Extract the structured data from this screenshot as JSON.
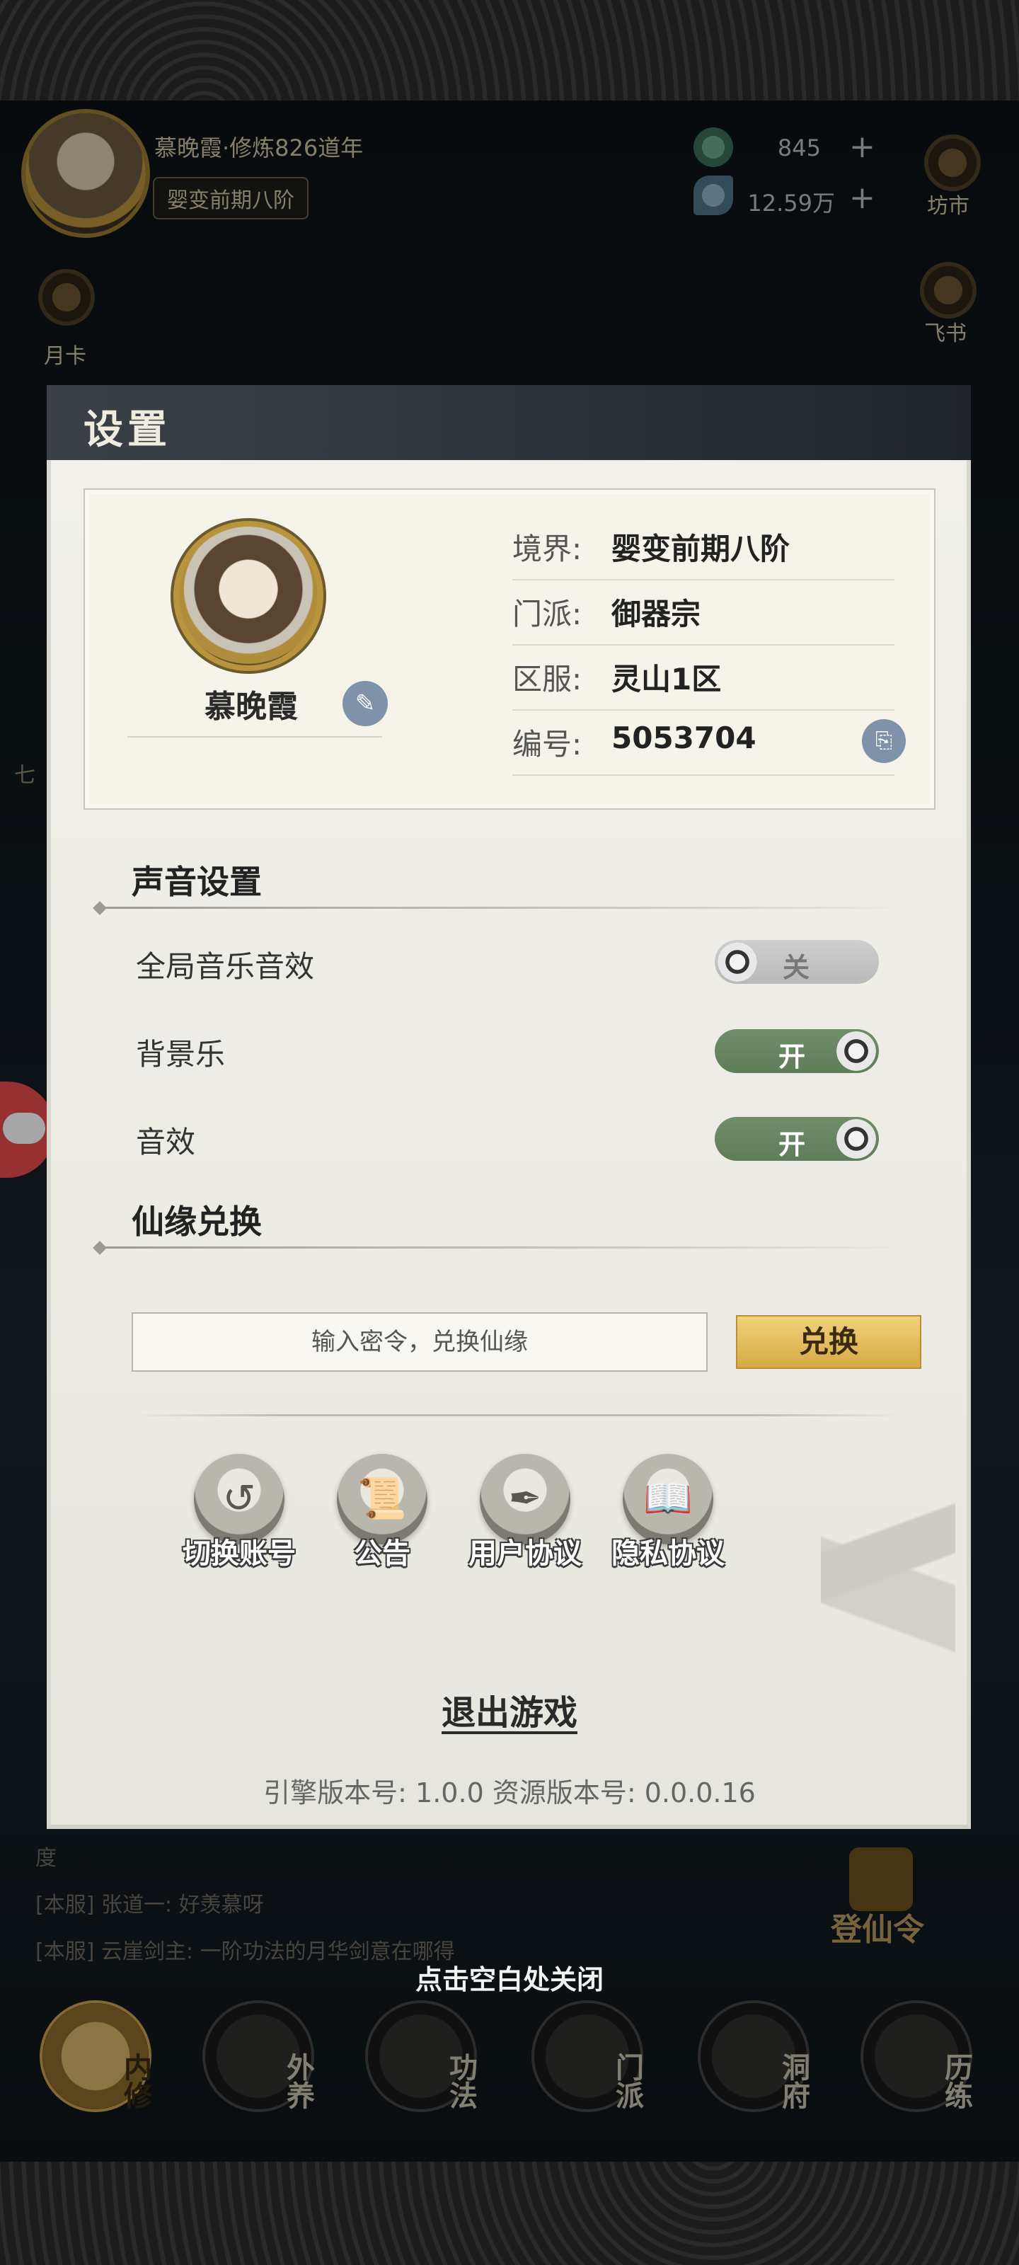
{
  "hud": {
    "player_name": "慕晚霞·修炼826道年",
    "realm_badge": "婴变前期八阶",
    "currency": [
      {
        "icon": "jade-coin-icon",
        "value": "845"
      },
      {
        "icon": "spirit-stone-icon",
        "value": "12.59万"
      }
    ],
    "plus": "+",
    "market_label": "坊市",
    "monthly_card_label": "月卡",
    "flying_book_label": "飞书",
    "side_glyph": "七"
  },
  "chat": {
    "rows": [
      "度",
      "[本服] 张道一: 好羡慕呀",
      "[本服] 云崖剑主: 一阶功法的月华剑意在哪得"
    ]
  },
  "dengxian_label": "登仙令",
  "close_hint": "点击空白处关闭",
  "bottom_nav": [
    {
      "label": "内修",
      "active": true
    },
    {
      "label": "外养",
      "active": false
    },
    {
      "label": "功法",
      "active": false
    },
    {
      "label": "门派",
      "active": false
    },
    {
      "label": "洞府",
      "active": false
    },
    {
      "label": "历练",
      "active": false
    }
  ],
  "settings": {
    "title": "设置",
    "profile": {
      "name": "慕晚霞",
      "fields": [
        {
          "key": "境界:",
          "value": "婴变前期八阶"
        },
        {
          "key": "门派:",
          "value": "御器宗"
        },
        {
          "key": "区服:",
          "value": "灵山1区"
        },
        {
          "key": "编号:",
          "value": "5053704"
        }
      ]
    },
    "sound": {
      "title": "声音设置",
      "items": [
        {
          "label": "全局音乐音效",
          "state": "关",
          "on": false
        },
        {
          "label": "背景乐",
          "state": "开",
          "on": true
        },
        {
          "label": "音效",
          "state": "开",
          "on": true
        }
      ]
    },
    "redeem": {
      "title": "仙缘兑换",
      "placeholder": "输入密令，兑换仙缘",
      "button": "兑换"
    },
    "actions": [
      {
        "label": "切换账号",
        "icon": "switch-account-icon"
      },
      {
        "label": "公告",
        "icon": "announcement-scroll-icon"
      },
      {
        "label": "用户协议",
        "icon": "user-agreement-scroll-icon"
      },
      {
        "label": "隐私协议",
        "icon": "privacy-book-icon"
      }
    ],
    "quit": "退出游戏",
    "version": "引擎版本号: 1.0.0 资源版本号: 0.0.0.16"
  }
}
